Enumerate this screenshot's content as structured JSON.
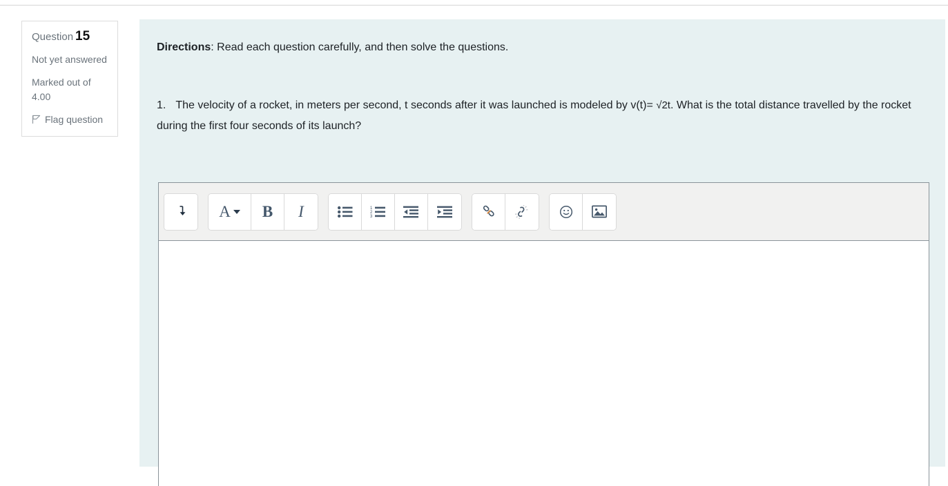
{
  "question_info": {
    "label": "Question",
    "number": "15",
    "state": "Not yet answered",
    "grade": "Marked out of 4.00",
    "flag_label": "Flag question",
    "flag_icon": "flag-icon"
  },
  "content": {
    "directions_label": "Directions",
    "directions_text": ": Read each question carefully, and then solve the questions.",
    "question_number": "1.",
    "question_body_before": "The velocity of a rocket, in meters per second, t seconds after it was launched is modeled by  v(t)= ",
    "question_formula": "√2t",
    "question_body_after": ". What is the total distance travelled by the rocket during the first four seconds of its launch?"
  },
  "editor": {
    "toolbar_groups": [
      {
        "name": "expand",
        "buttons": [
          {
            "name": "expand-toolbar-button",
            "icon": "arrow-down-corner-icon",
            "label": ""
          }
        ]
      },
      {
        "name": "formatting",
        "buttons": [
          {
            "name": "text-styles-button",
            "icon": "letter-a-caret-icon",
            "label": "A"
          },
          {
            "name": "bold-button",
            "icon": "bold-icon",
            "label": "B"
          },
          {
            "name": "italic-button",
            "icon": "italic-icon",
            "label": "I"
          }
        ]
      },
      {
        "name": "lists",
        "buttons": [
          {
            "name": "bulleted-list-button",
            "icon": "bulleted-list-icon",
            "label": ""
          },
          {
            "name": "numbered-list-button",
            "icon": "numbered-list-icon",
            "label": ""
          },
          {
            "name": "outdent-button",
            "icon": "outdent-icon",
            "label": ""
          },
          {
            "name": "indent-button",
            "icon": "indent-icon",
            "label": ""
          }
        ]
      },
      {
        "name": "links",
        "buttons": [
          {
            "name": "insert-link-button",
            "icon": "link-icon",
            "label": ""
          },
          {
            "name": "unlink-button",
            "icon": "unlink-icon",
            "label": ""
          }
        ]
      },
      {
        "name": "media",
        "buttons": [
          {
            "name": "emoji-button",
            "icon": "smiley-icon",
            "label": ""
          },
          {
            "name": "insert-image-button",
            "icon": "image-icon",
            "label": ""
          }
        ]
      }
    ],
    "answer_text": ""
  },
  "colors": {
    "panel_background": "#e7f1f2",
    "editor_border": "#8a9399",
    "toolbar_background": "#f1f1f0",
    "icon_color": "#46586b",
    "muted_text": "#6a737b"
  }
}
